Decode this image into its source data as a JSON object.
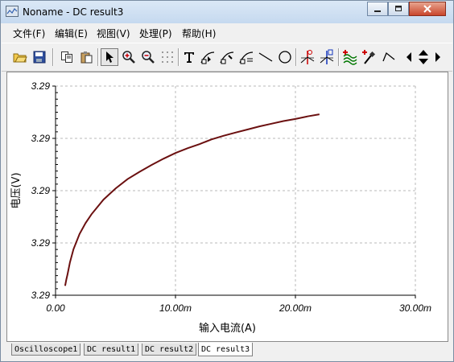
{
  "window": {
    "title": "Noname - DC result3"
  },
  "menu": [
    "文件(F)",
    "编辑(E)",
    "视图(V)",
    "处理(P)",
    "帮助(H)"
  ],
  "toolbar_icons": [
    "open-folder-icon",
    "save-icon",
    "copy-icon",
    "paste-icon",
    "pointer-icon",
    "zoom-in-icon",
    "zoom-out-icon",
    "grid-icon",
    "text-icon",
    "cursor-tool-1-icon",
    "cursor-tool-2-icon",
    "cursor-tool-3-icon",
    "line-icon",
    "ellipse-icon",
    "cursor-a-icon",
    "cursor-b-icon",
    "waves-icon",
    "probe-icon",
    "step-icon",
    "scroll-left-icon",
    "scroll-updown-icon",
    "scroll-right-icon"
  ],
  "tabs": [
    "Oscilloscope1",
    "DC result1",
    "DC result2",
    "DC result3"
  ],
  "active_tab": 3,
  "colors": {
    "trace": "#6b1010",
    "grid": "#b8b8b8",
    "titlebar": "#c5d9ef"
  },
  "chart_data": {
    "type": "line",
    "title": "",
    "xlabel": "输入电流(A)",
    "ylabel": "电压(V)",
    "x_tick_labels": [
      "0.00",
      "10.00m",
      "20.00m",
      "30.00m"
    ],
    "y_tick_labels": [
      "3.29",
      "3.29",
      "3.29",
      "3.29",
      "3.29"
    ],
    "xlim": [
      0,
      0.03
    ],
    "ylim": [
      0,
      4
    ],
    "grid": true,
    "series": [
      {
        "x": [
          0.0008,
          0.0009,
          0.001,
          0.0012,
          0.0015,
          0.002,
          0.0025,
          0.003,
          0.004,
          0.005,
          0.006,
          0.007,
          0.008,
          0.009,
          0.01,
          0.011,
          0.012,
          0.013,
          0.014,
          0.015,
          0.016,
          0.017,
          0.018,
          0.019,
          0.02,
          0.021,
          0.022
        ],
        "y": [
          0.18,
          0.3,
          0.4,
          0.63,
          0.88,
          1.17,
          1.38,
          1.55,
          1.83,
          2.04,
          2.22,
          2.36,
          2.49,
          2.61,
          2.72,
          2.81,
          2.89,
          2.98,
          3.05,
          3.11,
          3.17,
          3.23,
          3.28,
          3.33,
          3.37,
          3.42,
          3.46
        ]
      }
    ]
  }
}
